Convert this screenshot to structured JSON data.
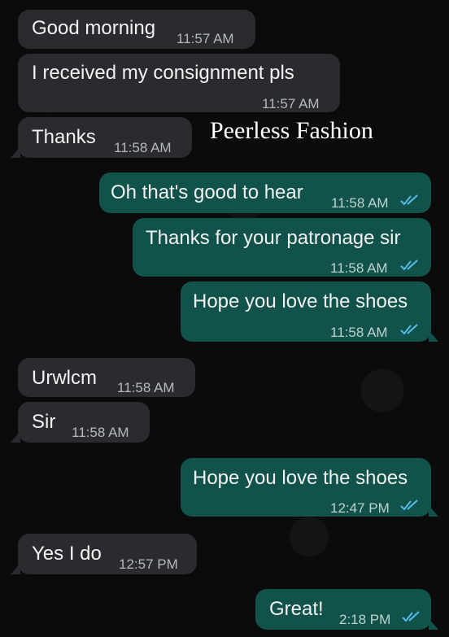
{
  "watermark": "Peerless Fashion",
  "colors": {
    "incoming_bubble": "#2a2b2e",
    "outgoing_bubble": "#11524a",
    "read_ticks": "#53bdeb"
  },
  "messages": [
    {
      "text": "Good morning",
      "time": "11:57 AM",
      "direction": "incoming"
    },
    {
      "text": "I received my consignment pls",
      "time": "11:57 AM",
      "direction": "incoming"
    },
    {
      "text": "Thanks",
      "time": "11:58 AM",
      "direction": "incoming"
    },
    {
      "text": "Oh that's good to hear",
      "time": "11:58 AM",
      "direction": "outgoing",
      "status": "read"
    },
    {
      "text": "Thanks for your patronage sir",
      "time": "11:58 AM",
      "direction": "outgoing",
      "status": "read"
    },
    {
      "text": "Hope you love the shoes",
      "time": "11:58 AM",
      "direction": "outgoing",
      "status": "read"
    },
    {
      "text": "Urwlcm",
      "time": "11:58 AM",
      "direction": "incoming"
    },
    {
      "text": "Sir",
      "time": "11:58 AM",
      "direction": "incoming"
    },
    {
      "text": "Hope you love the shoes",
      "time": "12:47 PM",
      "direction": "outgoing",
      "status": "read"
    },
    {
      "text": "Yes I do",
      "time": "12:57 PM",
      "direction": "incoming"
    },
    {
      "text": "Great!",
      "time": "2:18 PM",
      "direction": "outgoing",
      "status": "read"
    }
  ]
}
